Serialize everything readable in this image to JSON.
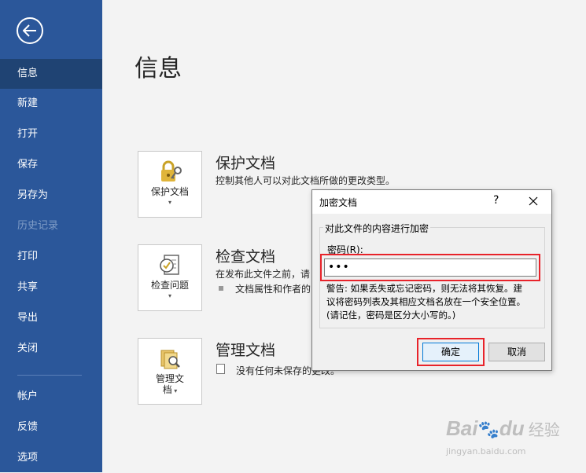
{
  "sidebar": {
    "items": [
      {
        "label": "信息",
        "state": "active"
      },
      {
        "label": "新建"
      },
      {
        "label": "打开"
      },
      {
        "label": "保存"
      },
      {
        "label": "另存为"
      },
      {
        "label": "历史记录",
        "state": "disabled"
      },
      {
        "label": "打印"
      },
      {
        "label": "共享"
      },
      {
        "label": "导出"
      },
      {
        "label": "关闭"
      },
      {
        "label": "帐户"
      },
      {
        "label": "反馈"
      },
      {
        "label": "选项"
      }
    ]
  },
  "main": {
    "title": "信息",
    "sections": [
      {
        "tile_label": "保护文档",
        "heading": "保护文档",
        "text": "控制其他人可以对此文档所做的更改类型。"
      },
      {
        "tile_label": "检查问题",
        "heading": "检查文档",
        "text": "在发布此文件之前，请",
        "bullet": "文档属性和作者的"
      },
      {
        "tile_label_line1": "管理文",
        "tile_label_line2": "档",
        "heading": "管理文档",
        "text": "没有任何未保存的更改。"
      }
    ]
  },
  "dialog": {
    "title": "加密文档",
    "help": "?",
    "group_label": "对此文件的内容进行加密",
    "password_label": "密码(R):",
    "password_value": "•••",
    "warning_line1": "警告: 如果丢失或忘记密码，则无法将其恢复。建",
    "warning_line2": "议将密码列表及其相应文档名放在一个安全位置。",
    "warning_line3": "(请记住，密码是区分大小写的。)",
    "ok_label": "确定",
    "cancel_label": "取消"
  },
  "watermark": {
    "logo": "Bai",
    "logo2": "du",
    "sub": "经验",
    "url": "jingyan.baidu.com"
  },
  "colors": {
    "sidebar": "#2b579a",
    "sidebar_active": "#1f4373",
    "highlight": "#e8232a"
  }
}
